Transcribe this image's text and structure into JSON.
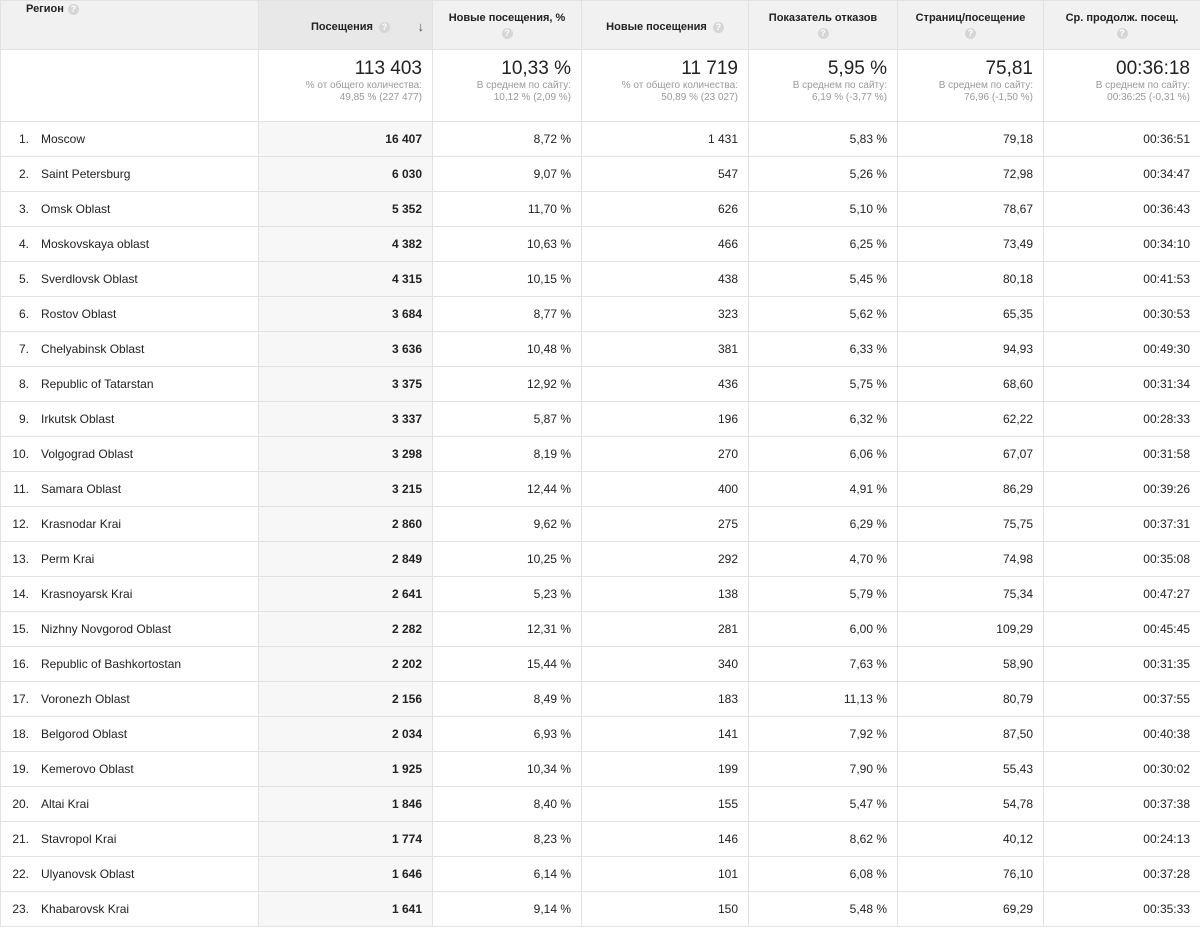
{
  "header": {
    "region": "Регион",
    "visits": "Посещения",
    "new_visits_pct": "Новые посещения, %",
    "new_visits": "Новые посещения",
    "bounce_rate": "Показатель отказов",
    "pages_per_visit": "Страниц/посещение",
    "avg_duration": "Ср. продолж. посещ.",
    "help_glyph": "?",
    "sort_glyph": "↓"
  },
  "totals": {
    "visits": {
      "value": "113 403",
      "sub1": "% от общего количества:",
      "sub2": "49,85 % (227 477)"
    },
    "new_visits_pct": {
      "value": "10,33 %",
      "sub1": "В среднем по сайту:",
      "sub2": "10,12 % (2,09 %)"
    },
    "new_visits": {
      "value": "11 719",
      "sub1": "% от общего количества:",
      "sub2": "50,89 % (23 027)"
    },
    "bounce_rate": {
      "value": "5,95 %",
      "sub1": "В среднем по сайту:",
      "sub2": "6,19 % (-3,77 %)"
    },
    "pages_per_visit": {
      "value": "75,81",
      "sub1": "В среднем по сайту:",
      "sub2": "76,96 (-1,50 %)"
    },
    "avg_duration": {
      "value": "00:36:18",
      "sub1": "В среднем по сайту:",
      "sub2": "00:36:25 (-0,31 %)"
    }
  },
  "rows": [
    {
      "idx": "1.",
      "region": "Moscow",
      "visits": "16 407",
      "new_pct": "8,72 %",
      "new": "1 431",
      "bounce": "5,83 %",
      "pages": "79,18",
      "duration": "00:36:51"
    },
    {
      "idx": "2.",
      "region": "Saint Petersburg",
      "visits": "6 030",
      "new_pct": "9,07 %",
      "new": "547",
      "bounce": "5,26 %",
      "pages": "72,98",
      "duration": "00:34:47"
    },
    {
      "idx": "3.",
      "region": "Omsk Oblast",
      "visits": "5 352",
      "new_pct": "11,70 %",
      "new": "626",
      "bounce": "5,10 %",
      "pages": "78,67",
      "duration": "00:36:43"
    },
    {
      "idx": "4.",
      "region": "Moskovskaya oblast",
      "visits": "4 382",
      "new_pct": "10,63 %",
      "new": "466",
      "bounce": "6,25 %",
      "pages": "73,49",
      "duration": "00:34:10"
    },
    {
      "idx": "5.",
      "region": "Sverdlovsk Oblast",
      "visits": "4 315",
      "new_pct": "10,15 %",
      "new": "438",
      "bounce": "5,45 %",
      "pages": "80,18",
      "duration": "00:41:53"
    },
    {
      "idx": "6.",
      "region": "Rostov Oblast",
      "visits": "3 684",
      "new_pct": "8,77 %",
      "new": "323",
      "bounce": "5,62 %",
      "pages": "65,35",
      "duration": "00:30:53"
    },
    {
      "idx": "7.",
      "region": "Chelyabinsk Oblast",
      "visits": "3 636",
      "new_pct": "10,48 %",
      "new": "381",
      "bounce": "6,33 %",
      "pages": "94,93",
      "duration": "00:49:30"
    },
    {
      "idx": "8.",
      "region": "Republic of Tatarstan",
      "visits": "3 375",
      "new_pct": "12,92 %",
      "new": "436",
      "bounce": "5,75 %",
      "pages": "68,60",
      "duration": "00:31:34"
    },
    {
      "idx": "9.",
      "region": "Irkutsk Oblast",
      "visits": "3 337",
      "new_pct": "5,87 %",
      "new": "196",
      "bounce": "6,32 %",
      "pages": "62,22",
      "duration": "00:28:33"
    },
    {
      "idx": "10.",
      "region": "Volgograd Oblast",
      "visits": "3 298",
      "new_pct": "8,19 %",
      "new": "270",
      "bounce": "6,06 %",
      "pages": "67,07",
      "duration": "00:31:58"
    },
    {
      "idx": "11.",
      "region": "Samara Oblast",
      "visits": "3 215",
      "new_pct": "12,44 %",
      "new": "400",
      "bounce": "4,91 %",
      "pages": "86,29",
      "duration": "00:39:26"
    },
    {
      "idx": "12.",
      "region": "Krasnodar Krai",
      "visits": "2 860",
      "new_pct": "9,62 %",
      "new": "275",
      "bounce": "6,29 %",
      "pages": "75,75",
      "duration": "00:37:31"
    },
    {
      "idx": "13.",
      "region": "Perm Krai",
      "visits": "2 849",
      "new_pct": "10,25 %",
      "new": "292",
      "bounce": "4,70 %",
      "pages": "74,98",
      "duration": "00:35:08"
    },
    {
      "idx": "14.",
      "region": "Krasnoyarsk Krai",
      "visits": "2 641",
      "new_pct": "5,23 %",
      "new": "138",
      "bounce": "5,79 %",
      "pages": "75,34",
      "duration": "00:47:27"
    },
    {
      "idx": "15.",
      "region": "Nizhny Novgorod Oblast",
      "visits": "2 282",
      "new_pct": "12,31 %",
      "new": "281",
      "bounce": "6,00 %",
      "pages": "109,29",
      "duration": "00:45:45"
    },
    {
      "idx": "16.",
      "region": "Republic of Bashkortostan",
      "visits": "2 202",
      "new_pct": "15,44 %",
      "new": "340",
      "bounce": "7,63 %",
      "pages": "58,90",
      "duration": "00:31:35"
    },
    {
      "idx": "17.",
      "region": "Voronezh Oblast",
      "visits": "2 156",
      "new_pct": "8,49 %",
      "new": "183",
      "bounce": "11,13 %",
      "pages": "80,79",
      "duration": "00:37:55"
    },
    {
      "idx": "18.",
      "region": "Belgorod Oblast",
      "visits": "2 034",
      "new_pct": "6,93 %",
      "new": "141",
      "bounce": "7,92 %",
      "pages": "87,50",
      "duration": "00:40:38"
    },
    {
      "idx": "19.",
      "region": "Kemerovo Oblast",
      "visits": "1 925",
      "new_pct": "10,34 %",
      "new": "199",
      "bounce": "7,90 %",
      "pages": "55,43",
      "duration": "00:30:02"
    },
    {
      "idx": "20.",
      "region": "Altai Krai",
      "visits": "1 846",
      "new_pct": "8,40 %",
      "new": "155",
      "bounce": "5,47 %",
      "pages": "54,78",
      "duration": "00:37:38"
    },
    {
      "idx": "21.",
      "region": "Stavropol Krai",
      "visits": "1 774",
      "new_pct": "8,23 %",
      "new": "146",
      "bounce": "8,62 %",
      "pages": "40,12",
      "duration": "00:24:13"
    },
    {
      "idx": "22.",
      "region": "Ulyanovsk Oblast",
      "visits": "1 646",
      "new_pct": "6,14 %",
      "new": "101",
      "bounce": "6,08 %",
      "pages": "76,10",
      "duration": "00:37:28"
    },
    {
      "idx": "23.",
      "region": "Khabarovsk Krai",
      "visits": "1 641",
      "new_pct": "9,14 %",
      "new": "150",
      "bounce": "5,48 %",
      "pages": "69,29",
      "duration": "00:35:33"
    }
  ]
}
